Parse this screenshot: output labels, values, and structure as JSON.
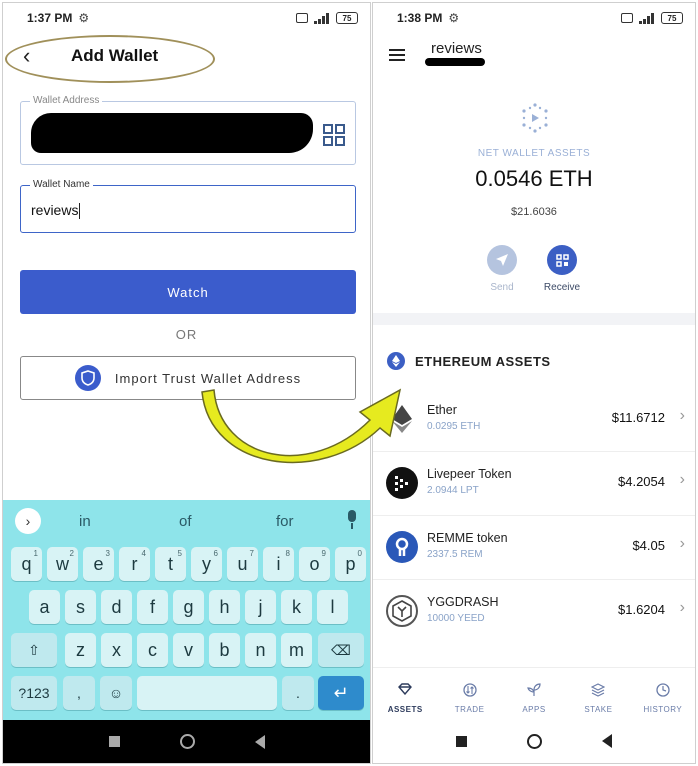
{
  "left_screen": {
    "status": {
      "time": "1:37 PM",
      "battery": "75"
    },
    "header": {
      "title": "Add Wallet"
    },
    "address_field": {
      "label": "Wallet Address"
    },
    "name_field": {
      "label": "Wallet Name",
      "value": "reviews"
    },
    "watch_button": {
      "label": "Watch"
    },
    "or_text": "OR",
    "import_button": {
      "label": "Import Trust Wallet Address"
    },
    "keyboard": {
      "suggestions": [
        "in",
        "of",
        "for"
      ],
      "row1": [
        {
          "k": "q",
          "n": "1"
        },
        {
          "k": "w",
          "n": "2"
        },
        {
          "k": "e",
          "n": "3"
        },
        {
          "k": "r",
          "n": "4"
        },
        {
          "k": "t",
          "n": "5"
        },
        {
          "k": "y",
          "n": "6"
        },
        {
          "k": "u",
          "n": "7"
        },
        {
          "k": "i",
          "n": "8"
        },
        {
          "k": "o",
          "n": "9"
        },
        {
          "k": "p",
          "n": "0"
        }
      ],
      "row2": [
        "a",
        "s",
        "d",
        "f",
        "g",
        "h",
        "j",
        "k",
        "l"
      ],
      "row3": [
        "z",
        "x",
        "c",
        "v",
        "b",
        "n",
        "m"
      ],
      "symbols_key": "?123",
      "comma_key": ",",
      "period_key": "."
    }
  },
  "right_screen": {
    "status": {
      "time": "1:38 PM",
      "battery": "75"
    },
    "wallet_name": "reviews",
    "net_label": "NET WALLET ASSETS",
    "net_value": "0.0546 ETH",
    "net_usd": "$21.6036",
    "actions": {
      "send": "Send",
      "receive": "Receive"
    },
    "section_title": "ETHEREUM ASSETS",
    "assets": [
      {
        "name": "Ether",
        "balance": "0.0295 ETH",
        "value": "$11.6712",
        "icon": "ether-icon",
        "color": "#ffffff"
      },
      {
        "name": "Livepeer Token",
        "balance": "2.0944 LPT",
        "value": "$4.2054",
        "icon": "livepeer-icon",
        "color": "#111111"
      },
      {
        "name": "REMME token",
        "balance": "2337.5 REM",
        "value": "$4.05",
        "icon": "remme-icon",
        "color": "#2a58b8"
      },
      {
        "name": "YGGDRASH",
        "balance": "10000 YEED",
        "value": "$1.6204",
        "icon": "yggdrash-icon",
        "color": "#ffffff"
      }
    ],
    "tabs": [
      {
        "label": "ASSETS",
        "icon": "diamond-icon",
        "active": true
      },
      {
        "label": "TRADE",
        "icon": "swap-icon",
        "active": false
      },
      {
        "label": "APPS",
        "icon": "sprout-icon",
        "active": false
      },
      {
        "label": "STAKE",
        "icon": "layers-icon",
        "active": false
      },
      {
        "label": "HISTORY",
        "icon": "clock-icon",
        "active": false
      }
    ]
  },
  "colors": {
    "primary": "#3b5ccc",
    "keyboard": "#8ee4ea",
    "arrow": "#e6ea1f"
  }
}
